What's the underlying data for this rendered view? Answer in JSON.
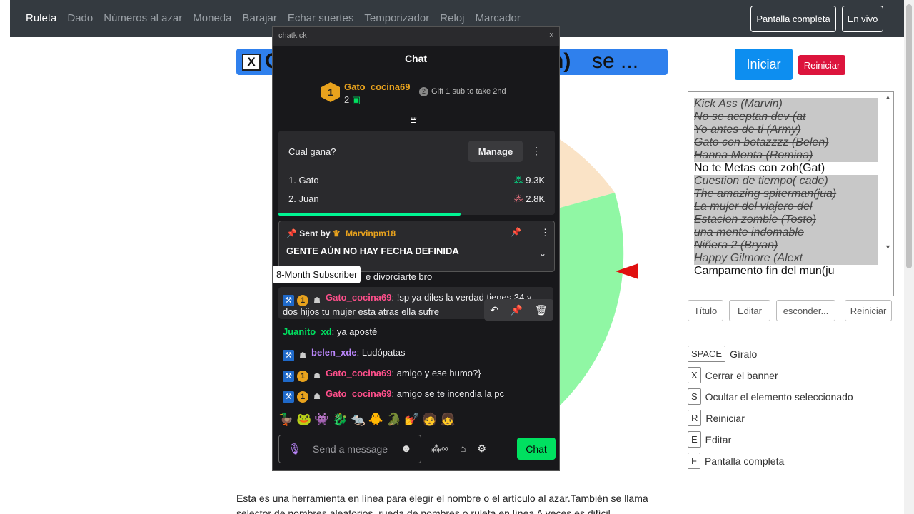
{
  "nav": {
    "links": [
      "Ruleta",
      "Dado",
      "Números al azar",
      "Moneda",
      "Barajar",
      "Echar suertes",
      "Temporizador",
      "Reloj",
      "Marcador"
    ],
    "fullscreen": "Pantalla completa",
    "live": "En vivo"
  },
  "banner": {
    "close": "X",
    "part1": "C",
    "part2": "n)",
    "part3": "se ..."
  },
  "controls": {
    "start": "Iniciar",
    "reset": "Reiniciar"
  },
  "entries": [
    {
      "text": "Kick Ass (Marvin)",
      "hidden": true
    },
    {
      "text": "No se aceptan dev (at",
      "hidden": true
    },
    {
      "text": "Yo antes de ti (Army)",
      "hidden": true
    },
    {
      "text": "Gato con botazzzz (Belen)",
      "hidden": true
    },
    {
      "text": "Hanna Monta (Romina)",
      "hidden": true
    },
    {
      "text": "No te Metas con zoh(Gat)",
      "hidden": false
    },
    {
      "text": "Cuestion de tiempo( cade)",
      "hidden": true
    },
    {
      "text": "The amazing spiterman(jua)",
      "hidden": true
    },
    {
      "text": "La mujer del viajero del",
      "hidden": true
    },
    {
      "text": "Estacion zombie (Tosto)",
      "hidden": true
    },
    {
      "text": "una mente indomable",
      "hidden": true
    },
    {
      "text": "Niñera 2 (Bryan)",
      "hidden": true
    },
    {
      "text": "Happy Gilmore (Alext",
      "hidden": true
    },
    {
      "text": "Campamento fin del mun(ju",
      "hidden": false
    }
  ],
  "list_buttons": [
    "Título",
    "Editar",
    "esconder...",
    "Reiniciar"
  ],
  "shortcuts": [
    {
      "key": "SPACE",
      "label": "Gíralo"
    },
    {
      "key": "X",
      "label": "Cerrar el banner"
    },
    {
      "key": "S",
      "label": "Ocultar el elemento seleccionado"
    },
    {
      "key": "R",
      "label": "Reiniciar"
    },
    {
      "key": "E",
      "label": "Editar"
    },
    {
      "key": "F",
      "label": "Pantalla completa"
    }
  ],
  "description": "Esta es una herramienta en línea para elegir el nombre o el artículo al azar.También se llama selector de nombres aleatorios, rueda de nombres o ruleta en línea A veces es difícil",
  "wheel_colors": {
    "peach": "#fae3c6",
    "green": "#90f7a4",
    "pointer": "#e01010"
  },
  "chat": {
    "window_name": "chatkick",
    "close": "x",
    "title": "Chat",
    "leader": {
      "rank": "1",
      "name": "Gato_cocina69",
      "count": "2",
      "gift_rank": "2",
      "gift_text": "Gift 1 sub to take 2nd"
    },
    "poll": {
      "question": "Cual gana?",
      "manage": "Manage",
      "options": [
        {
          "label": "1. Gato",
          "value": "9.3K"
        },
        {
          "label": "2. Juan",
          "value": "2.8K"
        }
      ],
      "progress": 0.66
    },
    "pinned": {
      "sent_by": "Sent by",
      "user": "Marvinpm18",
      "message": "GENTE AÚN NO HAY FECHA DEFINIDA"
    },
    "partial_line": "e divorciarte bro",
    "tooltip": "8-Month Subscriber",
    "messages": [
      {
        "user": "Gato_cocina69",
        "text": ": !sp ya diles la verdad tienes 34 y",
        "text2": "dos hijos tu mujer esta atras ella sufre"
      },
      {
        "user": "Juanito_xd",
        "text": ": ya aposté"
      },
      {
        "user": "belen_xde",
        "text": ": Ludópatas"
      },
      {
        "user": "Gato_cocina69",
        "text": ": amigo y ese humo?}"
      },
      {
        "user": "Gato_cocina69",
        "text": ": amigo se te incendia la pc"
      }
    ],
    "emotes": "🦆🐸👾🐉🐀🐥🐊💅🧑👧",
    "input_placeholder": "Send a message",
    "chat_button": "Chat"
  }
}
